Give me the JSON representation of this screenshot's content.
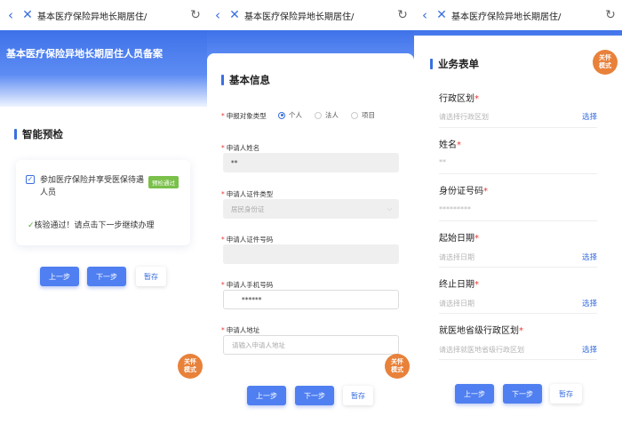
{
  "nav": {
    "back_glyph": "‹",
    "close_glyph": "✕",
    "title": "基本医疗保险异地长期居住/",
    "refresh_glyph": "↻"
  },
  "panel1": {
    "hero_title": "基本医疗保险异地长期居住人员备案",
    "section_title": "智能预检",
    "card": {
      "condition": "参加医疗保险并享受医保待遇人员",
      "badge": "预检通过",
      "result": "核验通过！请点击下一步继续办理"
    },
    "buttons": {
      "prev": "上一步",
      "next": "下一步",
      "save": "暂存"
    },
    "care_mode": "关怀模式"
  },
  "panel2": {
    "section_title": "基本信息",
    "applicant_type": {
      "label": "申报对象类型",
      "options": [
        "个人",
        "法人",
        "项目"
      ],
      "selected": "个人"
    },
    "fields": {
      "name": {
        "label": "申请人姓名",
        "value": "**"
      },
      "id_type": {
        "label": "申请人证件类型",
        "value": "居民身份证"
      },
      "id_number": {
        "label": "申请人证件号码",
        "value": ""
      },
      "phone": {
        "label": "申请人手机号码",
        "value": "******"
      },
      "address": {
        "label": "申请人地址",
        "placeholder": "请输入申请人地址"
      }
    },
    "buttons": {
      "prev": "上一步",
      "next": "下一步",
      "save": "暂存"
    },
    "care_mode": "关怀模式"
  },
  "panel3": {
    "section_title": "业务表单",
    "fields": {
      "region": {
        "label": "行政区划",
        "placeholder": "请选择行政区划",
        "action": "选择"
      },
      "name": {
        "label": "姓名",
        "value": "**"
      },
      "id_number": {
        "label": "身份证号码",
        "value": "*********"
      },
      "start_date": {
        "label": "起始日期",
        "placeholder": "请选择日期",
        "action": "选择"
      },
      "end_date": {
        "label": "终止日期",
        "placeholder": "请选择日期",
        "action": "选择"
      },
      "medical_region": {
        "label": "就医地省级行政区划",
        "placeholder": "请选择就医地省级行政区划",
        "action": "选择"
      }
    },
    "buttons": {
      "prev": "上一步",
      "next": "下一步",
      "save": "暂存"
    },
    "care_mode": "关怀模式"
  },
  "colors": {
    "primary": "#4f7ff0",
    "accent_orange": "#e8813a",
    "success_green": "#7ac04a",
    "required_red": "#e53935"
  }
}
